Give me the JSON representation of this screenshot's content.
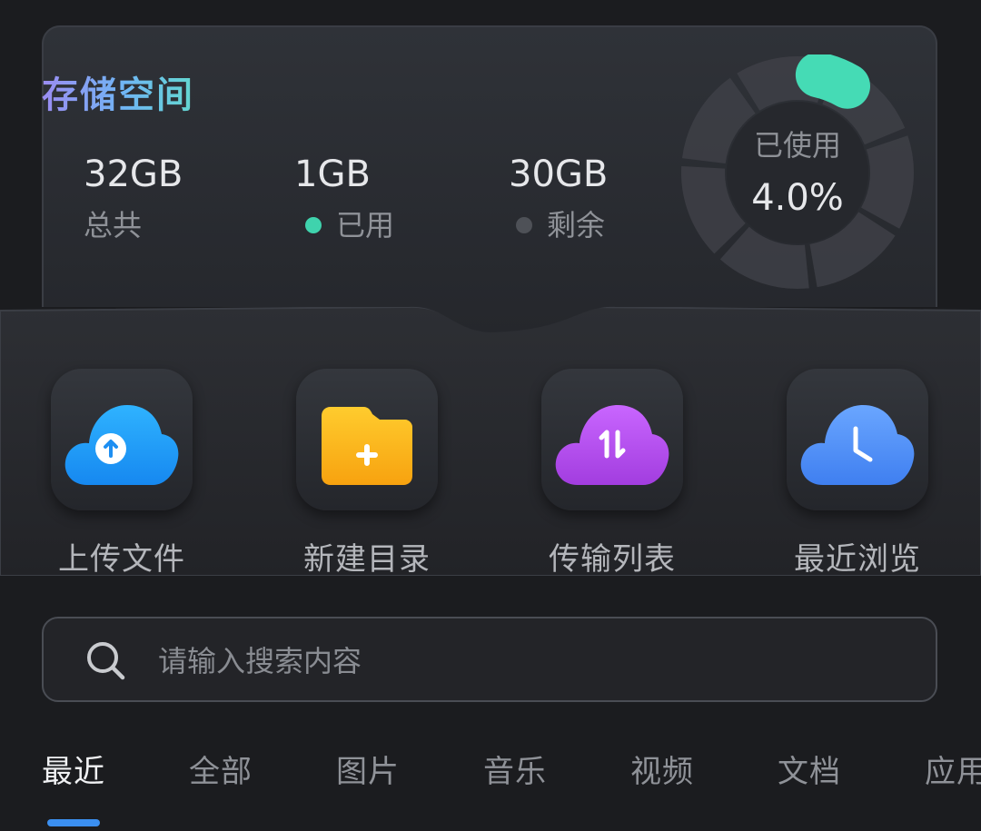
{
  "storage": {
    "title": "存储空间",
    "total": {
      "value": "32GB",
      "label": "总共"
    },
    "used": {
      "value": "1GB",
      "label": "已用",
      "dot_color": "#3fd3ad"
    },
    "free": {
      "value": "30GB",
      "label": "剩余",
      "dot_color": "#4e5157"
    },
    "usage": {
      "label": "已使用",
      "percent_text": "4.0%",
      "fraction": 0.04,
      "accent_color": "#45dbb5"
    }
  },
  "actions": [
    {
      "label": "上传文件",
      "icon": "cloud-upload-icon",
      "color": "#1e9af6"
    },
    {
      "label": "新建目录",
      "icon": "folder-add-icon",
      "color": "#f9b316"
    },
    {
      "label": "传输列表",
      "icon": "cloud-transfer-icon",
      "color": "#b24ce6"
    },
    {
      "label": "最近浏览",
      "icon": "cloud-clock-icon",
      "color": "#4e8df4"
    }
  ],
  "search": {
    "placeholder": "请输入搜索内容",
    "icon": "search-icon"
  },
  "tabs": [
    {
      "label": "最近",
      "active": true
    },
    {
      "label": "全部",
      "active": false
    },
    {
      "label": "图片",
      "active": false
    },
    {
      "label": "音乐",
      "active": false
    },
    {
      "label": "视频",
      "active": false
    },
    {
      "label": "文档",
      "active": false
    },
    {
      "label": "应用",
      "active": false
    }
  ],
  "theme": {
    "background": "#1b1c1f",
    "active_tab_indicator": "#3b8ff0"
  }
}
